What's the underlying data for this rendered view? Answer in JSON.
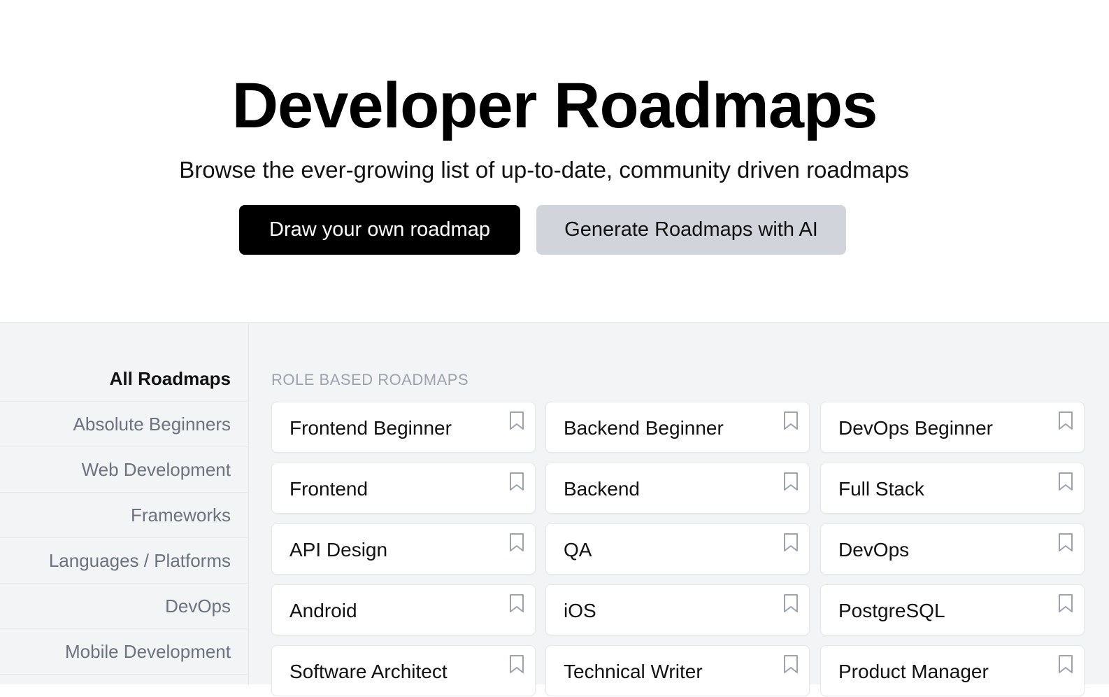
{
  "hero": {
    "title": "Developer Roadmaps",
    "subtitle": "Browse the ever-growing list of up-to-date, community driven roadmaps",
    "primary_button": "Draw your own roadmap",
    "secondary_button": "Generate Roadmaps with AI"
  },
  "sidebar": {
    "items": [
      {
        "label": "All Roadmaps",
        "active": true
      },
      {
        "label": "Absolute Beginners",
        "active": false
      },
      {
        "label": "Web Development",
        "active": false
      },
      {
        "label": "Frameworks",
        "active": false
      },
      {
        "label": "Languages / Platforms",
        "active": false
      },
      {
        "label": "DevOps",
        "active": false
      },
      {
        "label": "Mobile Development",
        "active": false
      }
    ]
  },
  "main": {
    "section_title": "ROLE BASED ROADMAPS",
    "cards": [
      "Frontend Beginner",
      "Backend Beginner",
      "DevOps Beginner",
      "Frontend",
      "Backend",
      "Full Stack",
      "API Design",
      "QA",
      "DevOps",
      "Android",
      "iOS",
      "PostgreSQL",
      "Software Architect",
      "Technical Writer",
      "Product Manager"
    ],
    "card_icon": "bookmark-icon"
  },
  "colors": {
    "primary_button_bg": "#000000",
    "secondary_button_bg": "#d1d5db",
    "content_bg": "#f3f4f6"
  }
}
